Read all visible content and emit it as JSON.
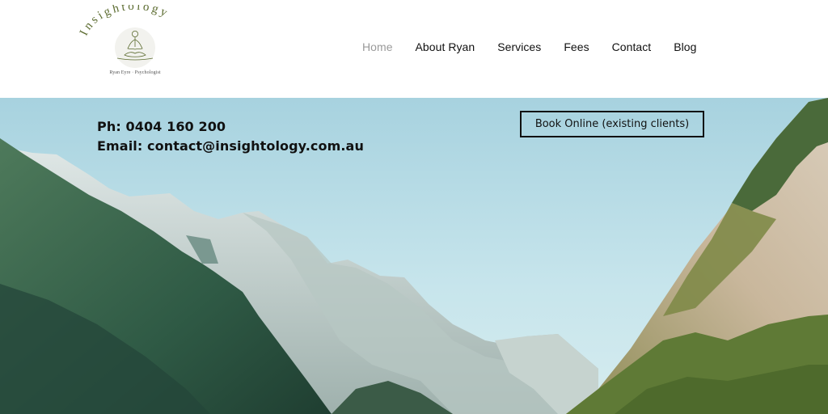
{
  "brand": {
    "logo_wordmark": "Insightology",
    "logo_subtitle": "Ryan Eyre · Psychologist"
  },
  "nav": {
    "items": [
      {
        "label": "Home",
        "active": true
      },
      {
        "label": "About Ryan",
        "active": false
      },
      {
        "label": "Services",
        "active": false
      },
      {
        "label": "Fees",
        "active": false
      },
      {
        "label": "Contact",
        "active": false
      },
      {
        "label": "Blog",
        "active": false
      }
    ],
    "active_color": "#9a9a9a",
    "text_color": "#111111"
  },
  "hero": {
    "phone": "Ph: 0404 160 200",
    "email": "Email: contact@insightology.com.au",
    "book_button": "Book Online (existing clients)",
    "image": "mountain-valley-photo",
    "sky_color": "#b9dde6"
  },
  "colors": {
    "logo_green": "#5b6b2f"
  }
}
